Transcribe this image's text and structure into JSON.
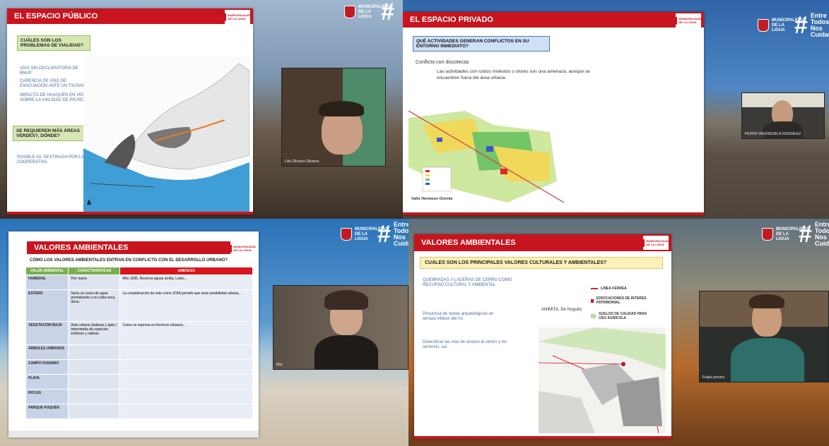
{
  "branding": {
    "municipality": "MUNICIPALIDAD DE LA LIGUA",
    "hashtag": "#",
    "tagline": "Entre Todos Nos Cuidamos"
  },
  "tiles": [
    {
      "slide_title": "EL ESPACIO PÚBLICO",
      "question": "CUÁLES SON LOS PROBLEMAS DE VIALIDAD?",
      "notes": [
        "VÍAS SIN DECLARATORIA DE BNUP",
        "CARENCIA DE VÍAS DE EVACUACIÓN ANTE UN TSUNAMI",
        "IMPACTO DE HUAQUÉN EN VERANO SOBRE LA VIALIDAD DE PICHICUY"
      ],
      "question2": "SE REQUIEREN MÁS ÁREAS VERDES?, DÓNDE?",
      "note2": "POSIBLE AV. DESTINADA POR LA COOPERATIVA",
      "participant": "Lilia Olivares Olivares"
    },
    {
      "slide_title": "EL ESPACIO PRIVADO",
      "question": "QUÉ ACTIVIDADES GENERAN CONFLICTOS EN SU ENTORNO INMEDIATO?",
      "conflict": "Conflicto con discotecas",
      "detail": "Las actividades con ruidos molestos u olores son una amenaza, aunque se encuentren fuera del área urbana.",
      "map_label": "Valle Hermoso Oriente",
      "participant": "PEDRO VALENZUELA GONZALEZ"
    },
    {
      "slide_title": "VALORES AMBIENTALES",
      "question": "CÓMO LOS VALORES AMBIENTALES ENTRAN EN CONFLICTO CON EL DESARROLLO URBANO?",
      "table_headers": [
        "VALOR AMBIENTAL",
        "CARACTERÍSTICAS",
        "AMENAZA"
      ],
      "rows": [
        {
          "name": "HUMEDAL",
          "feature": "Flor Isana",
          "threat": "Año 1996, Reserva aguas arriba, Lotes..."
        },
        {
          "name": "ESTERO",
          "feature": "Sería un curso de agua permanente y no cuba seca, duna.",
          "threat": "La consideración de este como ZOIA permite que sean posibilidad urbana..."
        },
        {
          "name": "VEGETACIÓN BAJA",
          "feature": "Ante urbano (laderas y apto.) intervenida de especies exóticas y nativas",
          "threat": "Como se expresa en terrenos urbanos..."
        },
        {
          "name": "ÁRBOLES URBANOS",
          "feature": "",
          "threat": ""
        },
        {
          "name": "CAMPO DUNARIO",
          "feature": "",
          "threat": ""
        },
        {
          "name": "PLAYA",
          "feature": "",
          "threat": ""
        },
        {
          "name": "ROCAS",
          "feature": "",
          "threat": ""
        },
        {
          "name": "PARQUE PUQUÉN",
          "feature": "",
          "threat": ""
        }
      ],
      "participant": "Mar"
    },
    {
      "slide_title": "VALORES AMBIENTALES",
      "question": "CUÁLES SON LOS PRINCIPALES VALORES CULTURALES Y AMBIENTALES?",
      "notes": [
        "QUEBRADAS Y LADERAS DE CERRO COMO RECURSO CULTURAL Y AMBIENTAL",
        "Presencia de restos arqueológicos en terraza inferior del río",
        "Diversificar las vías de acceso al centro y los servicios, así"
      ],
      "place": "ANIMITA, De Huguito",
      "legend": [
        "LÍNEA FÉRREA",
        "EDIFICACIONES DE INTERÉS PATRIMONIAL",
        "SUELOS DE CALIDAD PARA USO AGRÍCOLA"
      ],
      "legend_colors": [
        "#d9242b",
        "#c4141e",
        "#b8dca0"
      ],
      "participant": "Felipe persico"
    }
  ]
}
